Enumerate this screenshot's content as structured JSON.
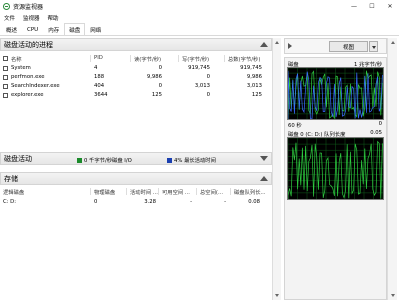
{
  "window": {
    "title": "资源监视器",
    "minimize": "—",
    "maximize": "☐",
    "close": "✕"
  },
  "menu": [
    "文件",
    "监视器",
    "帮助"
  ],
  "tabs": [
    "概述",
    "CPU",
    "内存",
    "磁盘",
    "网络"
  ],
  "disk_activity_processes": {
    "title": "磁盘活动的进程",
    "columns": [
      "名称",
      "PID",
      "读(字节/秒)",
      "写(字节/秒)",
      "总数(字节/秒)"
    ],
    "rows": [
      [
        "System",
        "4",
        "0",
        "919,745",
        "919,745"
      ],
      [
        "perfmon.exe",
        "188",
        "9,986",
        "0",
        "9,986"
      ],
      [
        "SearchIndexer.exe",
        "404",
        "0",
        "3,013",
        "3,013"
      ],
      [
        "explorer.exe",
        "3644",
        "125",
        "0",
        "125"
      ]
    ]
  },
  "disk_activity": {
    "title": "磁盘活动",
    "io_legend": "0 千字节/秒磁盘 I/O",
    "active_legend": "4% 最长活动时间",
    "colors": {
      "io": "#1a8a2a",
      "active": "#1a3fb0"
    }
  },
  "storage": {
    "title": "存储",
    "columns": [
      "逻辑磁盘",
      "物理磁盘",
      "活动时间 ...",
      "可用空间 ...",
      "总空间(...",
      "磁盘队列长..."
    ],
    "rows": [
      [
        "C: D:",
        "0",
        "3.28",
        "-",
        "-",
        "0.08"
      ]
    ]
  },
  "right_panel": {
    "view_label": "视图",
    "disk_graph": {
      "label": "磁盘",
      "scale": "1 兆字节/秒",
      "time": "60 秒",
      "min": "0"
    },
    "queue_graph": {
      "label": "磁盘 0 (C: D:) 队列长度",
      "scale": "0.05"
    }
  }
}
